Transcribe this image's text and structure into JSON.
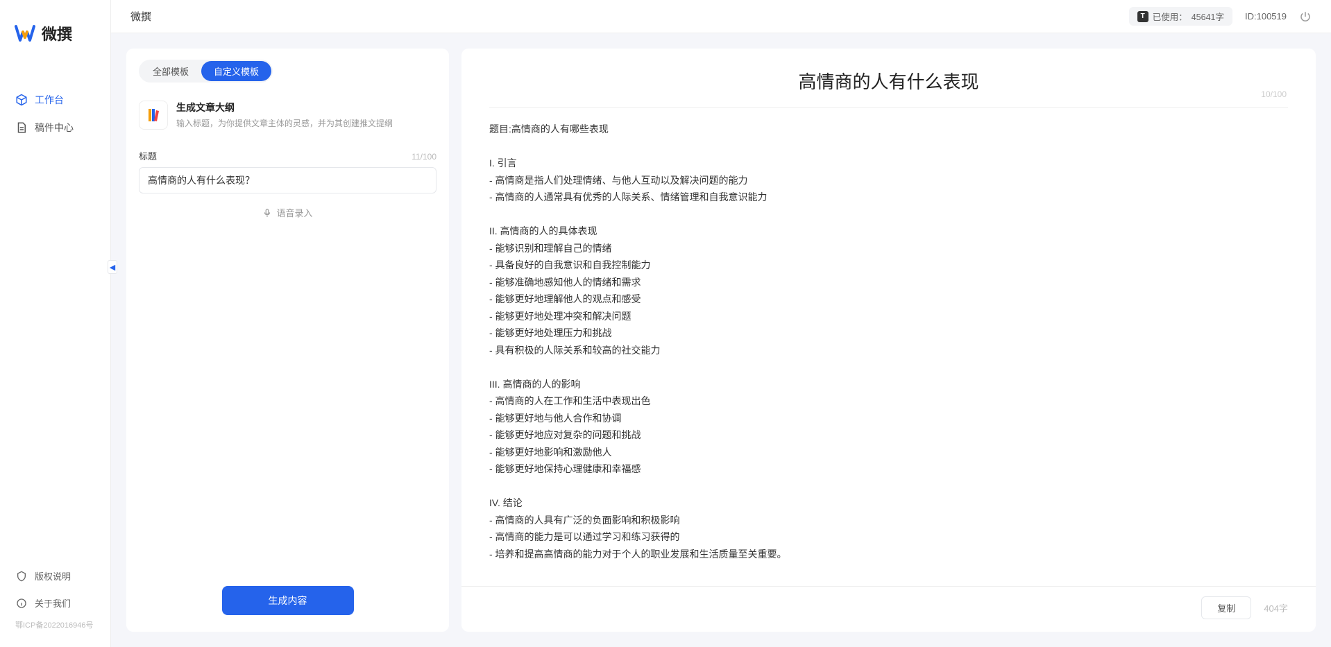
{
  "brand": {
    "name": "微撰"
  },
  "sidebar": {
    "nav": [
      {
        "label": "工作台",
        "icon": "cube-icon",
        "active": true
      },
      {
        "label": "稿件中心",
        "icon": "document-icon",
        "active": false
      }
    ],
    "bottom": [
      {
        "label": "版权说明",
        "icon": "shield-icon"
      },
      {
        "label": "关于我们",
        "icon": "info-icon"
      }
    ],
    "icp": "鄂ICP备2022016946号"
  },
  "topbar": {
    "title": "微撰",
    "usage_prefix": "已使用：",
    "usage_value": "45641字",
    "id_label": "ID:100519"
  },
  "left_panel": {
    "tabs": [
      {
        "label": "全部模板",
        "active": false
      },
      {
        "label": "自定义模板",
        "active": true
      }
    ],
    "template": {
      "title": "生成文章大纲",
      "desc": "输入标题，为你提供文章主体的灵感，并为其创建推文提纲"
    },
    "form": {
      "title_label": "标题",
      "title_counter": "11/100",
      "title_value": "高情商的人有什么表现？"
    },
    "voice_label": "语音录入",
    "generate_label": "生成内容"
  },
  "output": {
    "title": "高情商的人有什么表现",
    "counter": "10/100",
    "body": "题目:高情商的人有哪些表现\n\nI. 引言\n- 高情商是指人们处理情绪、与他人互动以及解决问题的能力\n- 高情商的人通常具有优秀的人际关系、情绪管理和自我意识能力\n\nII. 高情商的人的具体表现\n- 能够识别和理解自己的情绪\n- 具备良好的自我意识和自我控制能力\n- 能够准确地感知他人的情绪和需求\n- 能够更好地理解他人的观点和感受\n- 能够更好地处理冲突和解决问题\n- 能够更好地处理压力和挑战\n- 具有积极的人际关系和较高的社交能力\n\nIII. 高情商的人的影响\n- 高情商的人在工作和生活中表现出色\n- 能够更好地与他人合作和协调\n- 能够更好地应对复杂的问题和挑战\n- 能够更好地影响和激励他人\n- 能够更好地保持心理健康和幸福感\n\nIV. 结论\n- 高情商的人具有广泛的负面影响和积极影响\n- 高情商的能力是可以通过学习和练习获得的\n- 培养和提高高情商的能力对于个人的职业发展和生活质量至关重要。",
    "copy_label": "复制",
    "word_count": "404字"
  }
}
